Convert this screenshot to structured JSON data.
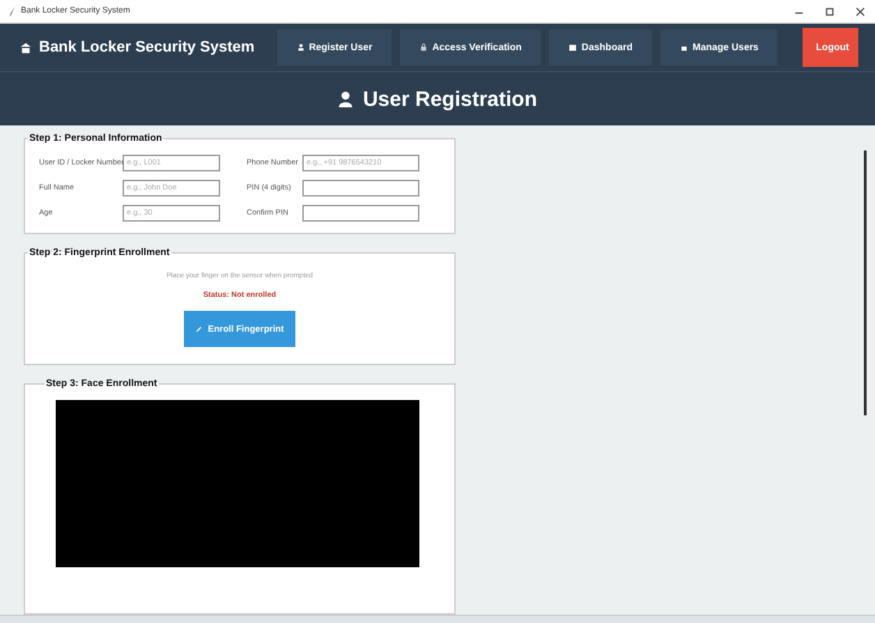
{
  "window": {
    "title": "Bank Locker Security System"
  },
  "navbar": {
    "brand": "Bank Locker Security System",
    "items": [
      {
        "label": "Register User"
      },
      {
        "label": "Access Verification"
      },
      {
        "label": "Dashboard"
      },
      {
        "label": "Manage Users"
      }
    ],
    "logout": "Logout"
  },
  "page_title": "User Registration",
  "step1": {
    "title": "Step 1: Personal Information",
    "fields": [
      {
        "label": "User ID / Locker Number",
        "placeholder": "e.g., L001"
      },
      {
        "label": "Phone Number",
        "placeholder": "e.g., +91 9876543210"
      },
      {
        "label": "Full Name",
        "placeholder": "e.g., John Doe"
      },
      {
        "label": "PIN (4 digits)"
      },
      {
        "label": "Age",
        "placeholder": "e.g., 30"
      },
      {
        "label": "Confirm PIN"
      }
    ]
  },
  "step2": {
    "title": "Step 2: Fingerprint Enrollment",
    "hint": "Place your finger on the sensor when prompted",
    "status": "Status: Not enrolled",
    "button": "Enroll Fingerprint"
  },
  "step3": {
    "title": "Step 3: Face Enrollment"
  }
}
